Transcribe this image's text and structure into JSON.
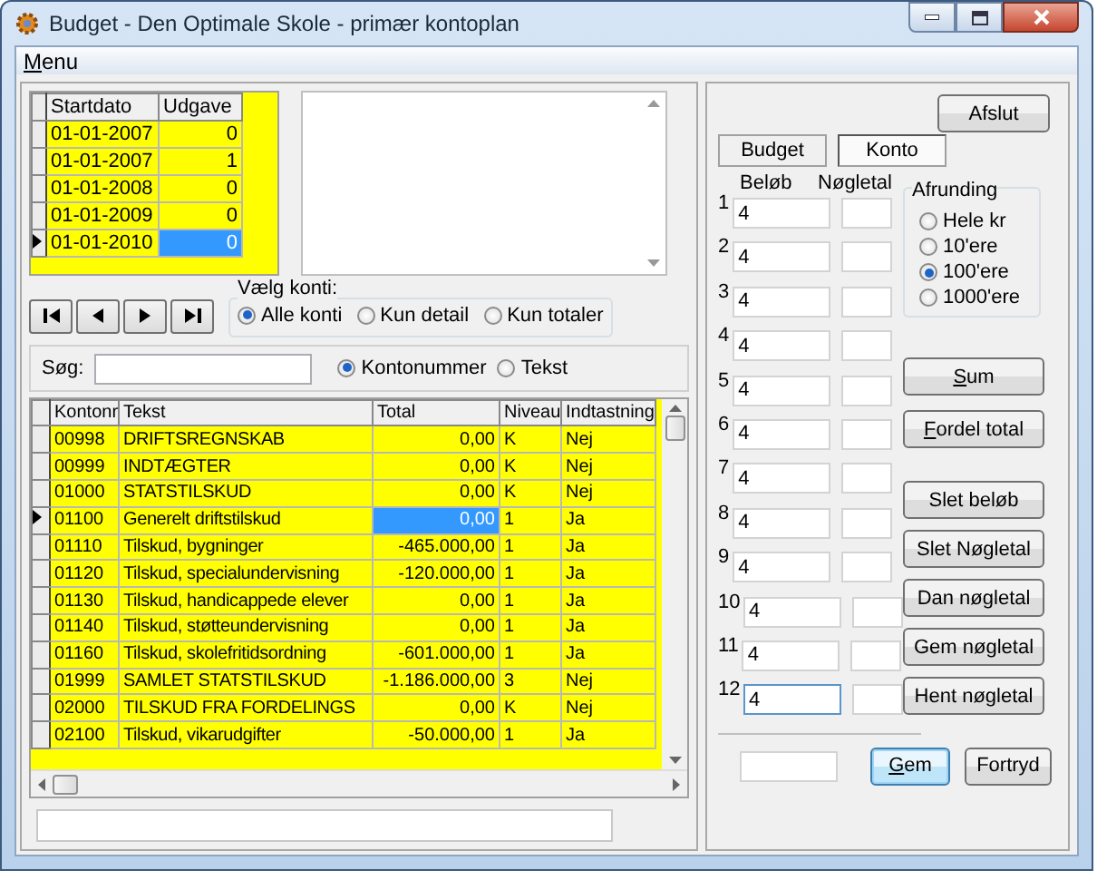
{
  "window": {
    "title": "Budget - Den Optimale Skole - primær kontoplan"
  },
  "menu": [
    {
      "label": "Menu",
      "underline_first": true
    }
  ],
  "editions": {
    "columns": [
      "Startdato",
      "Udgave"
    ],
    "rows": [
      {
        "start": "01-01-2007",
        "version": "0",
        "selected": false
      },
      {
        "start": "01-01-2007",
        "version": "1",
        "selected": false
      },
      {
        "start": "01-01-2008",
        "version": "0",
        "selected": false
      },
      {
        "start": "01-01-2009",
        "version": "0",
        "selected": false
      },
      {
        "start": "01-01-2010",
        "version": "0",
        "selected": true
      }
    ]
  },
  "account_filter": {
    "label": "Vælg konti:",
    "options": [
      {
        "label": "Alle konti",
        "selected": true
      },
      {
        "label": "Kun detail",
        "selected": false
      },
      {
        "label": "Kun totaler",
        "selected": false
      }
    ]
  },
  "search": {
    "label": "Søg:",
    "options": [
      {
        "label": "Kontonummer",
        "selected": true
      },
      {
        "label": "Tekst",
        "selected": false
      }
    ]
  },
  "accounts": {
    "columns": [
      "Kontonr",
      "Tekst",
      "Total",
      "Niveau",
      "Indtastning"
    ],
    "rows": [
      {
        "cells": [
          "00998",
          "DRIFTSREGNSKAB",
          "0,00",
          "K",
          "Nej"
        ],
        "selected": false
      },
      {
        "cells": [
          "00999",
          "INDTÆGTER",
          "0,00",
          "K",
          "Nej"
        ],
        "selected": false
      },
      {
        "cells": [
          "01000",
          "STATSTILSKUD",
          "0,00",
          "K",
          "Nej"
        ],
        "selected": false
      },
      {
        "cells": [
          "01100",
          "Generelt driftstilskud",
          "0,00",
          "1",
          "Ja"
        ],
        "selected": true
      },
      {
        "cells": [
          "01110",
          "Tilskud, bygninger",
          "-465.000,00",
          "1",
          "Ja"
        ],
        "selected": false
      },
      {
        "cells": [
          "01120",
          "Tilskud, specialundervisning",
          "-120.000,00",
          "1",
          "Ja"
        ],
        "selected": false
      },
      {
        "cells": [
          "01130",
          "Tilskud, handicappede elever",
          "0,00",
          "1",
          "Ja"
        ],
        "selected": false
      },
      {
        "cells": [
          "01140",
          "Tilskud, støtteundervisning",
          "0,00",
          "1",
          "Ja"
        ],
        "selected": false
      },
      {
        "cells": [
          "01160",
          "Tilskud, skolefritidsordning",
          "-601.000,00",
          "1",
          "Ja"
        ],
        "selected": false
      },
      {
        "cells": [
          "01999",
          "SAMLET STATSTILSKUD",
          "-1.186.000,00",
          "3",
          "Nej"
        ],
        "selected": false
      },
      {
        "cells": [
          "02000",
          "TILSKUD FRA FORDELINGS",
          "0,00",
          "K",
          "Nej"
        ],
        "selected": false
      },
      {
        "cells": [
          "02100",
          "Tilskud, vikarudgifter",
          "-50.000,00",
          "1",
          "Ja"
        ],
        "selected": false
      }
    ]
  },
  "close_button": {
    "label": "Afslut"
  },
  "tabs": [
    {
      "label": "Budget",
      "selected": false
    },
    {
      "label": "Konto",
      "selected": true
    }
  ],
  "amount_header": "Beløb",
  "key_header": "Nøgletal",
  "entries": [
    {
      "number": "1",
      "amount": "4",
      "focused": false
    },
    {
      "number": "2",
      "amount": "4",
      "focused": false
    },
    {
      "number": "3",
      "amount": "4",
      "focused": false
    },
    {
      "number": "4",
      "amount": "4",
      "focused": false
    },
    {
      "number": "5",
      "amount": "4",
      "focused": false
    },
    {
      "number": "6",
      "amount": "4",
      "focused": false
    },
    {
      "number": "7",
      "amount": "4",
      "focused": false
    },
    {
      "number": "8",
      "amount": "4",
      "focused": false
    },
    {
      "number": "9",
      "amount": "4",
      "focused": false
    },
    {
      "number": "10",
      "amount": "4",
      "focused": false
    },
    {
      "number": "11",
      "amount": "4",
      "focused": false
    },
    {
      "number": "12",
      "amount": "4",
      "focused": true
    }
  ],
  "rounding": {
    "label": "Afrunding",
    "options": [
      {
        "label": "Hele kr",
        "selected": false
      },
      {
        "label": "10'ere",
        "selected": false
      },
      {
        "label": "100'ere",
        "selected": true
      },
      {
        "label": "1000'ere",
        "selected": false
      }
    ]
  },
  "upper_buttons": [
    {
      "label": "Sum",
      "underline_first": true
    },
    {
      "label": "Fordel total",
      "underline_first": true
    }
  ],
  "lower_buttons": [
    {
      "label": "Slet beløb",
      "underline_first": false
    },
    {
      "label": "Slet Nøgletal",
      "underline_first": false
    },
    {
      "label": "Dan nøgletal",
      "underline_first": false
    },
    {
      "label": "Gem nøgletal",
      "underline_first": false
    },
    {
      "label": "Hent nøgletal",
      "underline_first": false
    }
  ],
  "footer_buttons": [
    {
      "label": "Gem",
      "underline_first": true,
      "default": true
    },
    {
      "label": "Fortryd",
      "underline_first": false,
      "default": false
    }
  ]
}
